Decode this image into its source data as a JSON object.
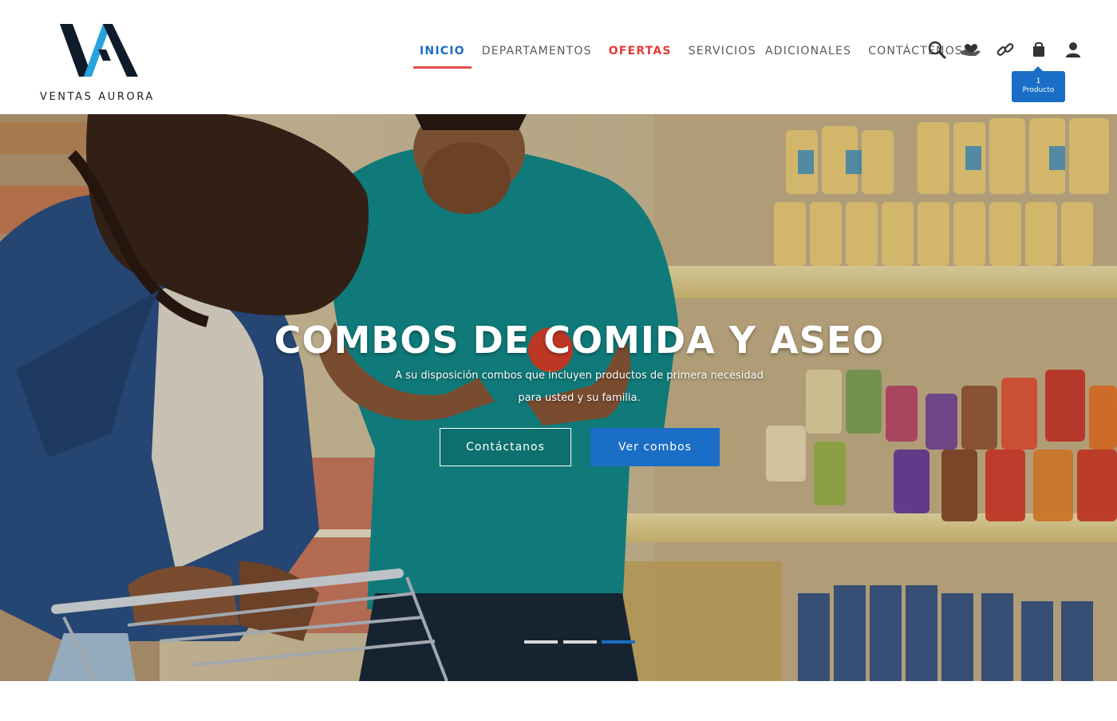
{
  "brand": {
    "name": "VENTAS AURORA",
    "logo_colors": {
      "dark": "#0d1b2a",
      "accent": "#29a3e0"
    }
  },
  "nav": {
    "items": [
      {
        "label": "INICIO",
        "state": "active"
      },
      {
        "label": "DEPARTAMENTOS",
        "state": "normal"
      },
      {
        "label": "OFERTAS",
        "state": "highlight"
      },
      {
        "label": "SERVICIOS  ADICIONALES",
        "state": "normal"
      },
      {
        "label": "CONTÁCTENOS",
        "state": "normal"
      }
    ],
    "active_color": "#1a6ec5",
    "offers_color": "#e23b3b",
    "underline_color": "#e84a4a"
  },
  "header_icons": [
    "search-icon",
    "donate-icon",
    "link-icon",
    "shopping-bag-icon",
    "user-icon"
  ],
  "cart": {
    "count": "1",
    "label": "Producto"
  },
  "hero": {
    "title": "COMBOS DE COMIDA Y ASEO",
    "subtitle_line1": "A su disposición combos que incluyen productos de primera necesidad",
    "subtitle_line2": "para usted y su familia.",
    "primary_button": "Ver combos",
    "secondary_button": "Contáctanos",
    "slide_count": 3,
    "active_slide": 3
  },
  "colors": {
    "primary": "#1a6ec5",
    "text_muted": "#555a60"
  }
}
